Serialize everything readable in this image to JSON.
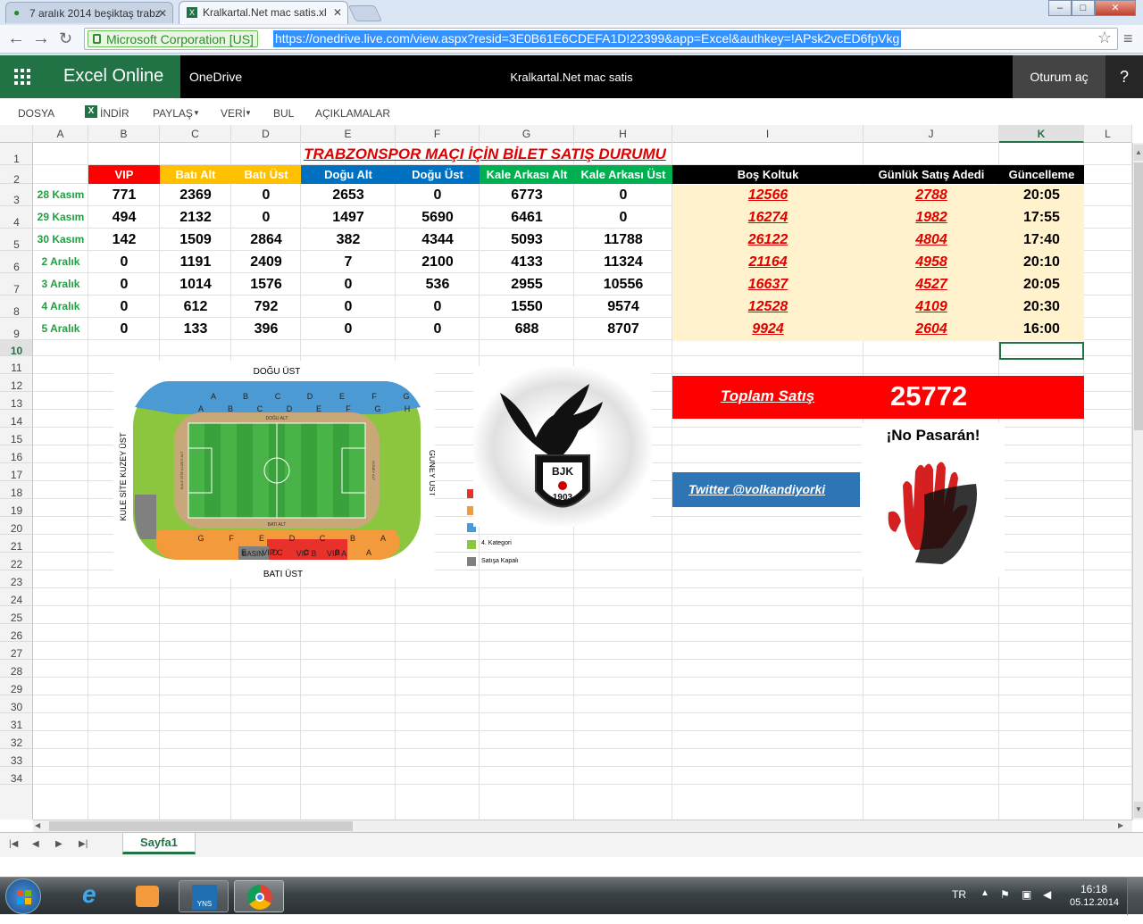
{
  "browser": {
    "tabs": [
      {
        "label": "7 aralık 2014 beşiktaş trabz",
        "active": false
      },
      {
        "label": "Kralkartal.Net mac satis.xl",
        "active": true
      }
    ],
    "ev_label": "Microsoft Corporation [US]",
    "url": "https://onedrive.live.com/view.aspx?resid=3E0B61E6CDEFA1D!22399&app=Excel&authkey=!APsk2vcED6fpVkg"
  },
  "app": {
    "brand": "Excel Online",
    "onedrive": "OneDrive",
    "doc_title": "Kralkartal.Net mac satis",
    "signin": "Oturum aç",
    "help": "?"
  },
  "ribbon": {
    "file": "DOSYA",
    "download": "İNDİR",
    "share": "PAYLAŞ",
    "data": "VERİ",
    "find": "BUL",
    "comments": "AÇIKLAMALAR"
  },
  "columns": [
    "A",
    "B",
    "C",
    "D",
    "E",
    "F",
    "G",
    "H",
    "I",
    "J",
    "K",
    "L"
  ],
  "rows": [
    "1",
    "2",
    "3",
    "4",
    "5",
    "6",
    "7",
    "8",
    "9",
    "10",
    "11",
    "12",
    "13",
    "14",
    "15",
    "16",
    "17",
    "18",
    "19",
    "20",
    "21",
    "22",
    "23",
    "24",
    "25",
    "26",
    "27",
    "28",
    "29",
    "30",
    "31",
    "32",
    "33",
    "34"
  ],
  "sheet": {
    "title": "TRABZONSPOR MAÇI İÇİN BİLET SATIŞ DURUMU",
    "headers": [
      "VIP",
      "Batı Alt",
      "Batı Üst",
      "Doğu Alt",
      "Doğu Üst",
      "Kale Arkası Alt",
      "Kale Arkası Üst",
      "Boş Koltuk",
      "Günlük Satış Adedi",
      "Güncelleme"
    ],
    "header_colors": [
      "#ff0000",
      "#ffc000",
      "#ffc000",
      "#0070c0",
      "#0070c0",
      "#00b050",
      "#00b050",
      "#000000",
      "#000000",
      "#000000"
    ],
    "data": [
      [
        "28 Kasım",
        "771",
        "2369",
        "0",
        "2653",
        "0",
        "6773",
        "0",
        "12566",
        "2788",
        "20:05"
      ],
      [
        "29 Kasım",
        "494",
        "2132",
        "0",
        "1497",
        "5690",
        "6461",
        "0",
        "16274",
        "1982",
        "17:55"
      ],
      [
        "30 Kasım",
        "142",
        "1509",
        "2864",
        "382",
        "4344",
        "5093",
        "11788",
        "26122",
        "4804",
        "17:40"
      ],
      [
        "2 Aralık",
        "0",
        "1191",
        "2409",
        "7",
        "2100",
        "4133",
        "11324",
        "21164",
        "4958",
        "20:10"
      ],
      [
        "3 Aralık",
        "0",
        "1014",
        "1576",
        "0",
        "536",
        "2955",
        "10556",
        "16637",
        "4527",
        "20:05"
      ],
      [
        "4 Aralık",
        "0",
        "612",
        "792",
        "0",
        "0",
        "1550",
        "9574",
        "12528",
        "4109",
        "20:30"
      ],
      [
        "5 Aralık",
        "0",
        "133",
        "396",
        "0",
        "0",
        "688",
        "8707",
        "9924",
        "2604",
        "16:00"
      ]
    ],
    "total_label": "Toplam Satış",
    "total_value": "25772",
    "twitter": "Twitter @volkandiyorki",
    "no_pasaran": "¡No Pasarán!",
    "bjk_year": "1903",
    "bjk_letters": "BJK"
  },
  "stadium": {
    "north": "DOĞU ÜST",
    "south": "BATI ÜST",
    "west": "KULE SİTE KUZEY ÜST",
    "east": "GÜNEY ÜST",
    "inner_north": "DOĞU ALT",
    "inner_south": "BATI ALT",
    "inner_west": "KULE SİTE KUZEY ALT",
    "inner_east": "GÜNEY ALT",
    "vip_c": "VIP C",
    "vip_b": "VIP B",
    "vip_a": "VIP A",
    "basin": "BASIN",
    "legend": [
      {
        "color": "#e8312b",
        "label": ""
      },
      {
        "color": "#f39a3d",
        "label": ""
      },
      {
        "color": "#4b9ad4",
        "label": ""
      },
      {
        "color": "#8cc63f",
        "label": "4. Kategori"
      },
      {
        "color": "#808080",
        "label": "Satışa Kapalı"
      }
    ],
    "top_letters": [
      "A",
      "B",
      "C",
      "D",
      "E",
      "F",
      "G"
    ],
    "top_letters2": [
      "A",
      "B",
      "C",
      "D",
      "E",
      "F",
      "G",
      "H"
    ],
    "bottom_letters": [
      "G",
      "F",
      "E",
      "D",
      "C",
      "B",
      "A"
    ],
    "bottom_letters2": [
      "E",
      "D",
      "C",
      "B",
      "A"
    ]
  },
  "sheet_tab": "Sayfa1",
  "taskbar": {
    "lang": "TR",
    "time": "16:18",
    "date": "05.12.2014"
  }
}
